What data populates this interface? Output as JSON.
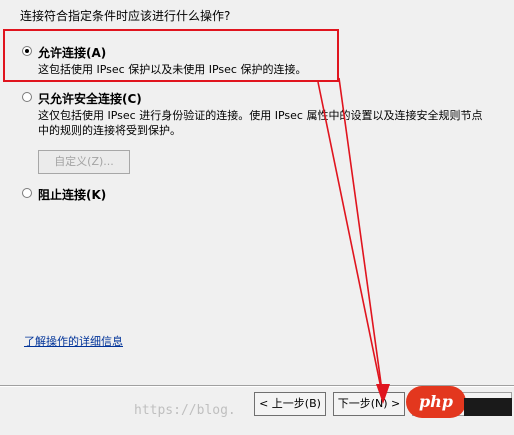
{
  "question": "连接符合指定条件时应该进行什么操作?",
  "options": [
    {
      "label": "允许连接(A)",
      "description": "这包括使用 IPsec 保护以及未使用 IPsec 保护的连接。",
      "selected": true
    },
    {
      "label": "只允许安全连接(C)",
      "description": "这仅包括使用 IPsec 进行身份验证的连接。使用 IPsec 属性中的设置以及连接安全规则节点中的规则的连接将受到保护。",
      "selected": false
    },
    {
      "label": "阻止连接(K)",
      "description": "",
      "selected": false
    }
  ],
  "customize_button": "自定义(Z)...",
  "learn_more_link": "了解操作的详细信息",
  "buttons": {
    "back": "< 上一步(B)",
    "next": "下一步(N) >",
    "cancel": ""
  },
  "watermark": "https://blog.",
  "logo_text": "php",
  "colors": {
    "annotation_red": "#e0141e",
    "link": "#003399",
    "php_logo": "#e3371e"
  }
}
